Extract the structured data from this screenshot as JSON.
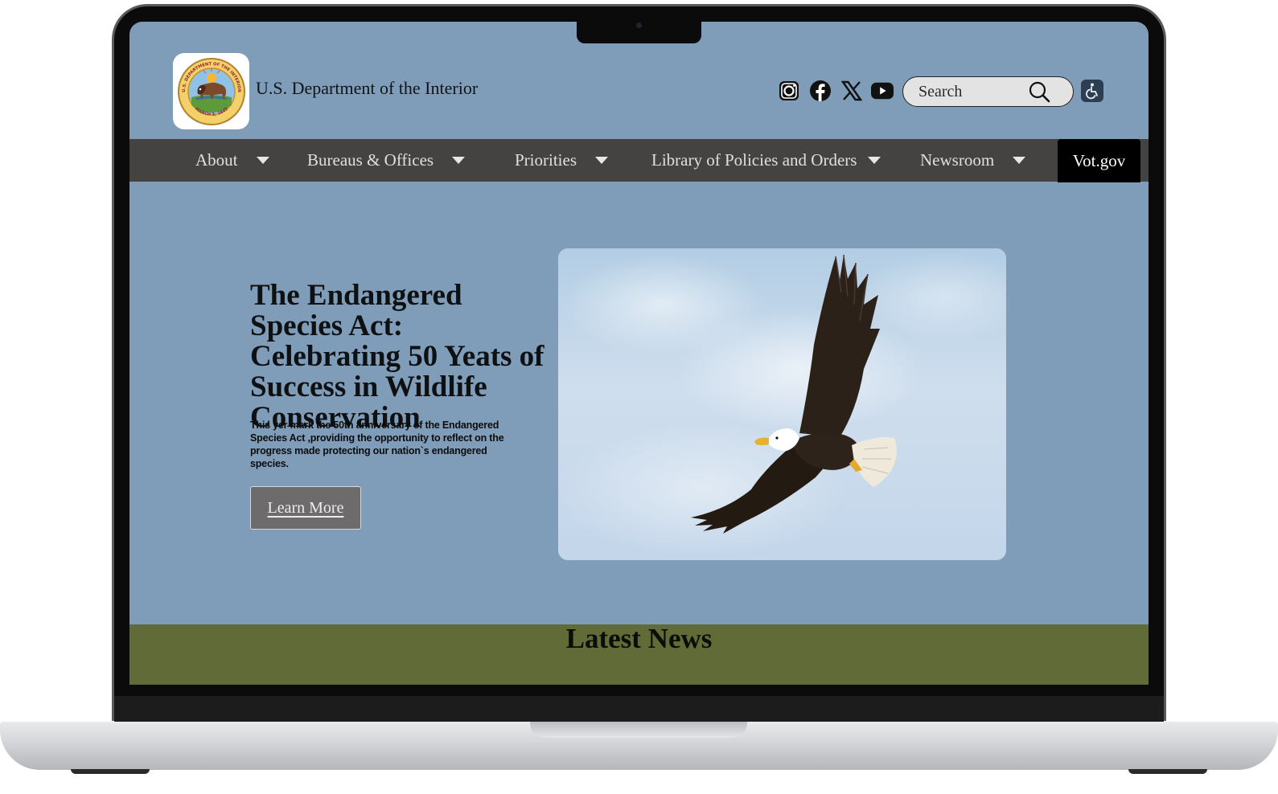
{
  "site": {
    "title": "U.S. Department of the Interior",
    "seal": {
      "top_text": "U.S. DEPARTMENT OF THE INTERIOR",
      "bottom_text": "MARCH 3, 1849"
    }
  },
  "social": [
    {
      "name": "instagram-icon"
    },
    {
      "name": "facebook-icon"
    },
    {
      "name": "x-icon"
    },
    {
      "name": "youtube-icon"
    }
  ],
  "search": {
    "placeholder": "Search",
    "icon": "search-icon"
  },
  "accessibility": {
    "icon": "accessibility-icon"
  },
  "nav": {
    "items": [
      {
        "label": "About"
      },
      {
        "label": "Bureaus & Offices"
      },
      {
        "label": "Priorities"
      },
      {
        "label": "Library of Policies and Orders"
      },
      {
        "label": "Newsroom"
      }
    ],
    "vot_label": "Vot.gov"
  },
  "hero": {
    "title": "The Endangered Species Act: Celebrating 50 Yeats of Success in Wildlife Conservation",
    "text": "This yer mark the 50th anniversary of the Endangered Species Act ,providing the opportunity to reflect on the progress made protecting our nation`s endangered species.",
    "button_label": "Learn More",
    "image": "bald-eagle-in-flight"
  },
  "news": {
    "title": "Latest News"
  },
  "colors": {
    "page_bg": "#7f9db9",
    "nav_bg": "#454342",
    "news_band": "#606b37",
    "button_bg": "#6d6b6b"
  }
}
